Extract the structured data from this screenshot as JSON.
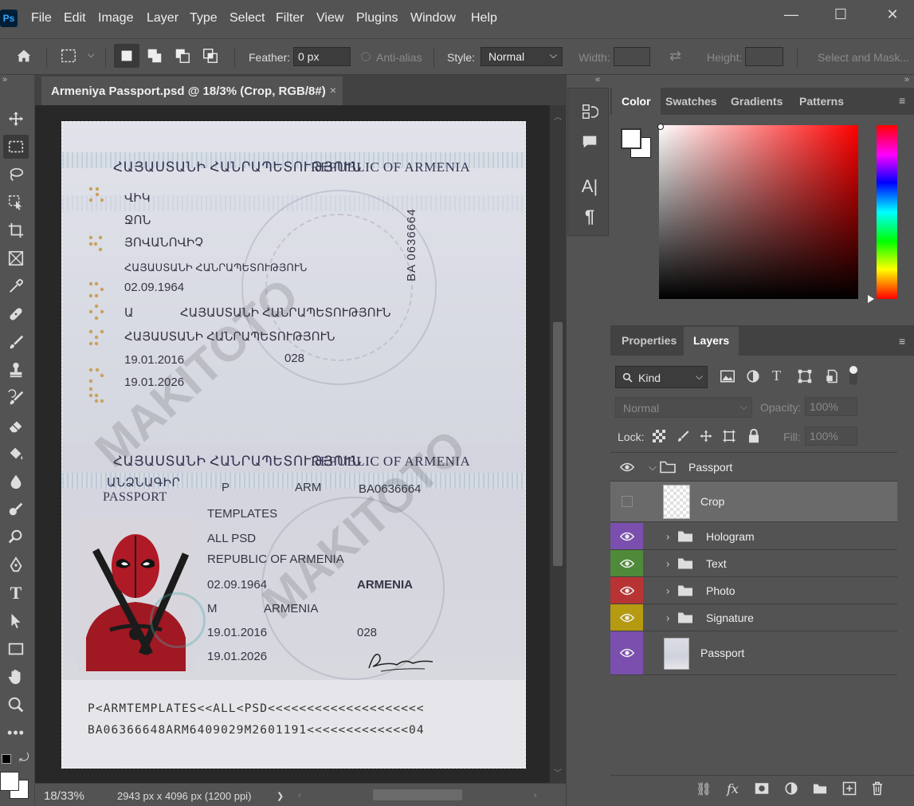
{
  "app": {
    "logo": "Ps"
  },
  "menu": [
    "File",
    "Edit",
    "Image",
    "Layer",
    "Type",
    "Select",
    "Filter",
    "View",
    "Plugins",
    "Window",
    "Help"
  ],
  "window_controls": {
    "minimize": "—",
    "maximize": "☐",
    "close": "✕"
  },
  "options_bar": {
    "feather_label": "Feather:",
    "feather_value": "0 px",
    "antialias_label": "Anti-alias",
    "style_label": "Style:",
    "style_value": "Normal",
    "width_label": "Width:",
    "height_label": "Height:",
    "select_mask_label": "Select and Mask..."
  },
  "document": {
    "tab_title": "Armeniya Passport.psd @ 18/3% (Crop, RGB/8#)",
    "close_glyph": "×"
  },
  "passport": {
    "header_arm": "ՀԱՅԱՍՏԱՆԻ ՀԱՆՐԱՊԵՏՈՒԹՅՈՒՆ",
    "header_en": "REPUBLIC OF ARMENIA",
    "top": {
      "surname": "ՎԻԿ",
      "given_name": "ՋՈՆ",
      "patronymic": "ՅՈՎԱՆՈՎԻՉ",
      "nationality": "ՀԱՅԱՍՏԱՆԻ ՀԱՆՐԱՊԵՏՈՒԹՅՈՒՆ",
      "dob": "02.09.1964",
      "sex": "Ա",
      "place_of_birth": "ՀԱՅԱՍՏԱՆԻ ՀԱՆՐԱՊԵՏՈՒԹՅՈՒՆ",
      "authority_text": "ՀԱՅԱՍՏԱՆԻ ՀԱՆՐԱՊԵՏՈՒԹՅՈՒՆ",
      "issue_date": "19.01.2016",
      "authority_code": "028",
      "expiry_date": "19.01.2026",
      "vertical_number": "BA 0636664"
    },
    "bottom": {
      "passport_arm": "ԱՆՁՆԱԳԻՐ",
      "passport_en": "PASSPORT",
      "type": "P",
      "code": "ARM",
      "number": "BA0636664",
      "surname": "TEMPLATES",
      "given_name": "ALL PSD",
      "nationality": "REPUBLIC OF ARMENIA",
      "dob": "02.09.1964",
      "residence": "ARMENIA",
      "sex": "M",
      "place_of_birth": "ARMENIA",
      "issue_date": "19.01.2016",
      "authority": "028",
      "expiry_date": "19.01.2026"
    },
    "mrz_line1": "P<ARMTEMPLATES<<ALL<PSD<<<<<<<<<<<<<<<<<<<<",
    "mrz_line2": "BA06366648ARM6409029M2601191<<<<<<<<<<<<<04"
  },
  "status": {
    "zoom": "18/33%",
    "dimensions": "2943 px x 4096 px (1200 ppi)",
    "arrow": "❯"
  },
  "color_panel": {
    "tabs": [
      "Color",
      "Swatches",
      "Gradients",
      "Patterns"
    ],
    "active_tab": "Color",
    "foreground": "#ffffff",
    "background": "#ffffff",
    "field_hue": "#ff0000"
  },
  "layers_panel": {
    "tabs": [
      "Properties",
      "Layers"
    ],
    "active_tab": "Layers",
    "filter_label": "Kind",
    "blend_mode": "Normal",
    "opacity_label": "Opacity:",
    "opacity_value": "100%",
    "lock_label": "Lock:",
    "fill_label": "Fill:",
    "fill_value": "100%",
    "layers": [
      {
        "name": "Passport",
        "type": "group",
        "expanded": true,
        "visible": true,
        "color": ""
      },
      {
        "name": "Crop",
        "type": "layer",
        "visible": false,
        "selected": true,
        "color": ""
      },
      {
        "name": "Hologram",
        "type": "group",
        "visible": true,
        "color": "#7a4fae"
      },
      {
        "name": "Text",
        "type": "group",
        "visible": true,
        "color": "#4f8a3a"
      },
      {
        "name": "Photo",
        "type": "group",
        "visible": true,
        "color": "#b83434"
      },
      {
        "name": "Signature",
        "type": "group",
        "visible": true,
        "color": "#b59a12"
      },
      {
        "name": "Passport",
        "type": "layer",
        "visible": true,
        "color": "#7a4fae"
      }
    ]
  },
  "watermark": "MAKITOTO"
}
